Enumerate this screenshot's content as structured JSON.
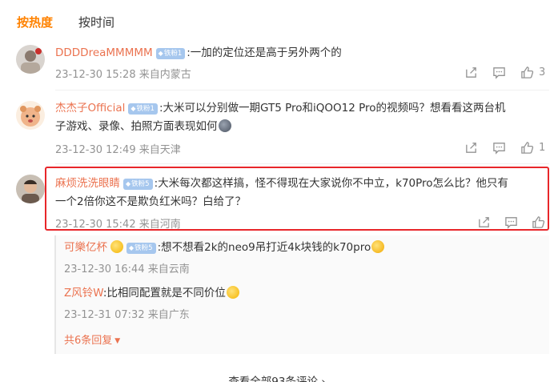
{
  "sort_tabs": {
    "hot": "按热度",
    "time": "按时间"
  },
  "comments": [
    {
      "user": "DDDDreaMMMMM",
      "badge": "铁粉1",
      "text": ":一加的定位还是高于另外两个的",
      "time": "23-12-30 15:28",
      "location": "来自内蒙古",
      "likes": "3"
    },
    {
      "user": "杰杰子Official",
      "badge": "铁粉1",
      "text_line1": ":大米可以分别做一期GT5 Pro和iQOO12 Pro的视频吗？想看看这两台机",
      "text_line2": "子游戏、录像、拍照方面表现如何",
      "time": "23-12-30 12:49",
      "location": "来自天津",
      "likes": "1"
    },
    {
      "user": "麻烦洗洗眼睛",
      "badge": "铁粉5",
      "text_line1": ":大米每次都这样搞，怪不得现在大家说你不中立，k70Pro怎么比？他只有",
      "text_line2": "一个2倍你这不是欺负红米吗？白给了？",
      "time": "23-12-30 15:42",
      "location": "来自河南"
    }
  ],
  "replies": [
    {
      "user": "可樂亿杯",
      "badge": "铁粉5",
      "text": ":想不想看2k的neo9吊打近4k块钱的k70pro",
      "time": "23-12-30 16:44",
      "location": "来自云南"
    },
    {
      "user": "Z风铃W",
      "text": ":比相同配置就是不同价位",
      "time": "23-12-31 07:32",
      "location": "来自广东"
    }
  ],
  "more_replies": "共6条回复",
  "view_all": "查看全部93条评论 ›",
  "colors": {
    "accent": "#ff8200",
    "username": "#eb7350",
    "highlight_border": "#e8262a",
    "meta": "#939393"
  },
  "icons": [
    "share-icon",
    "comment-icon",
    "like-icon",
    "caret-down-icon",
    "diamond-icon"
  ]
}
